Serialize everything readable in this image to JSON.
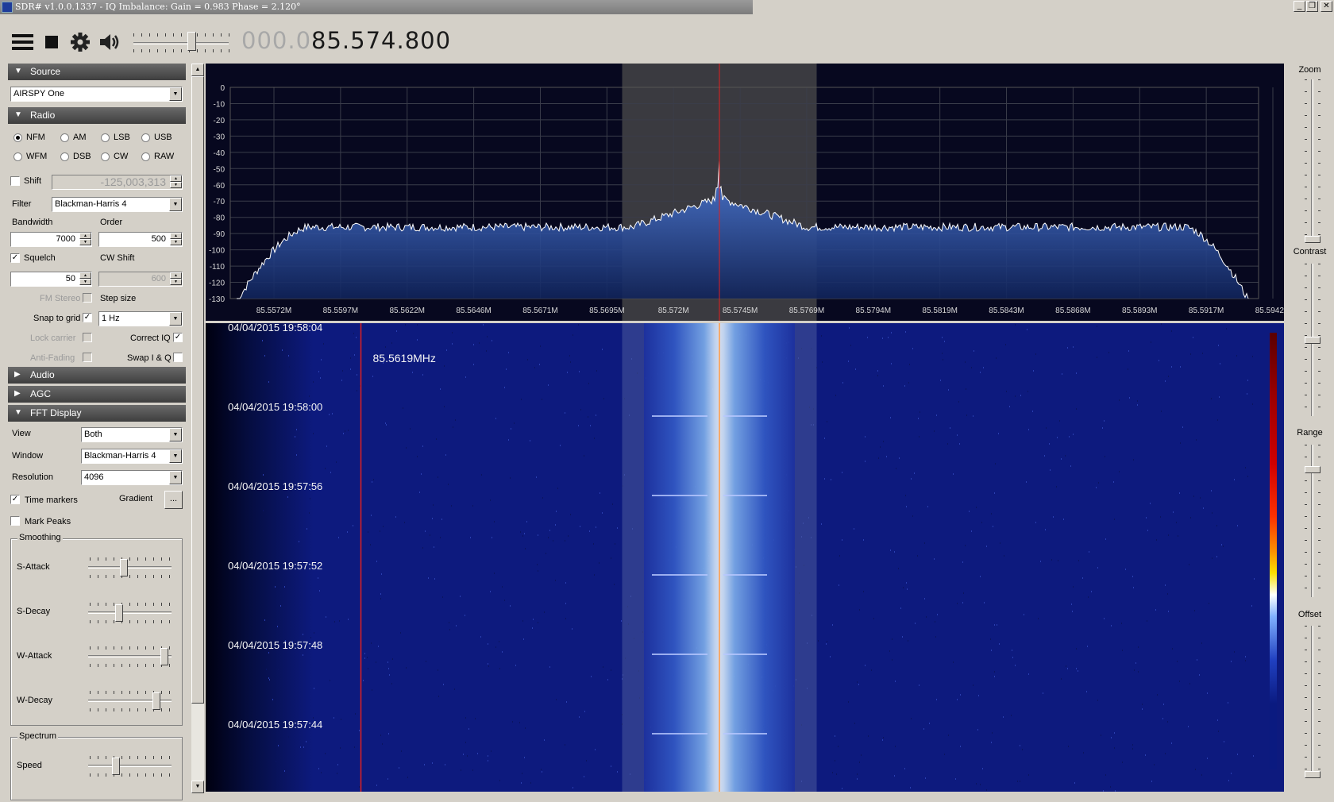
{
  "window": {
    "title": "SDR# v1.0.0.1337 - IQ Imbalance: Gain = 0.983 Phase = 2.120°",
    "minimize": "_",
    "maximize": "❐",
    "close": "✕"
  },
  "toolbar": {
    "frequency_dim": "000.0",
    "frequency_main": "85.574.800",
    "volume_level": 0.62
  },
  "source": {
    "header": "Source",
    "device": "AIRSPY One"
  },
  "radio": {
    "header": "Radio",
    "modes": [
      {
        "label": "NFM",
        "selected": true
      },
      {
        "label": "AM",
        "selected": false
      },
      {
        "label": "LSB",
        "selected": false
      },
      {
        "label": "USB",
        "selected": false
      },
      {
        "label": "WFM",
        "selected": false
      },
      {
        "label": "DSB",
        "selected": false
      },
      {
        "label": "CW",
        "selected": false
      },
      {
        "label": "RAW",
        "selected": false
      }
    ],
    "shift_label": "Shift",
    "shift_value": "-125,003,313",
    "filter_label": "Filter",
    "filter_value": "Blackman-Harris 4",
    "bandwidth_label": "Bandwidth",
    "bandwidth_value": "7000",
    "order_label": "Order",
    "order_value": "500",
    "squelch_label": "Squelch",
    "squelch_value": "50",
    "cwshift_label": "CW Shift",
    "cwshift_value": "600",
    "fmstereo_label": "FM Stereo",
    "stepsize_label": "Step size",
    "snap_label": "Snap to grid",
    "snap_value": "1 Hz",
    "lockcarrier_label": "Lock carrier",
    "correctiq_label": "Correct IQ",
    "antifading_label": "Anti-Fading",
    "swapiq_label": "Swap I & Q",
    "check_mark": "✓"
  },
  "audio": {
    "header": "Audio"
  },
  "agc": {
    "header": "AGC"
  },
  "fft": {
    "header": "FFT Display",
    "view_label": "View",
    "view_value": "Both",
    "window_label": "Window",
    "window_value": "Blackman-Harris 4",
    "resolution_label": "Resolution",
    "resolution_value": "4096",
    "timemarkers_label": "Time markers",
    "gradient_label": "Gradient",
    "gradient_button": "...",
    "markpeaks_label": "Mark Peaks",
    "smoothing_title": "Smoothing",
    "sattack_label": "S-Attack",
    "sdecay_label": "S-Decay",
    "wattack_label": "W-Attack",
    "wdecay_label": "W-Decay",
    "sattack_level": 0.42,
    "sdecay_level": 0.36,
    "wattack_level": 0.96,
    "wdecay_level": 0.85,
    "spectrum_title": "Spectrum",
    "speed_label": "Speed",
    "speed_level": 0.32
  },
  "right_panel": {
    "zoom_label": "Zoom",
    "contrast_label": "Contrast",
    "range_label": "Range",
    "offset_label": "Offset",
    "zoom_level": 0.0,
    "contrast_level": 0.5,
    "range_level": 0.85,
    "offset_level": 0.0
  },
  "spectrum": {
    "y_ticks": [
      "0",
      "-10",
      "-20",
      "-30",
      "-40",
      "-50",
      "-60",
      "-70",
      "-80",
      "-90",
      "-100",
      "-110",
      "-120",
      "-130"
    ],
    "x_ticks": [
      "85.5572M",
      "85.5597M",
      "85.5622M",
      "85.5646M",
      "85.5671M",
      "85.5695M",
      "85.572M",
      "85.5745M",
      "85.5769M",
      "85.5794M",
      "85.5819M",
      "85.5843M",
      "85.5868M",
      "85.5893M",
      "85.5917M",
      "85.5942M"
    ],
    "x_start_mhz": 85.5572,
    "x_end_mhz": 85.5942,
    "center_mhz": 85.5748,
    "filter_low_mhz": 85.5713,
    "filter_high_mhz": 85.5783
  },
  "waterfall": {
    "cursor_label": "85.5619MHz",
    "cursor_mhz": 85.5619,
    "time_markers": [
      "04/04/2015 19:58:04",
      "04/04/2015 19:58:00",
      "04/04/2015 19:57:56",
      "04/04/2015 19:57:52",
      "04/04/2015 19:57:48",
      "04/04/2015 19:57:44"
    ]
  }
}
